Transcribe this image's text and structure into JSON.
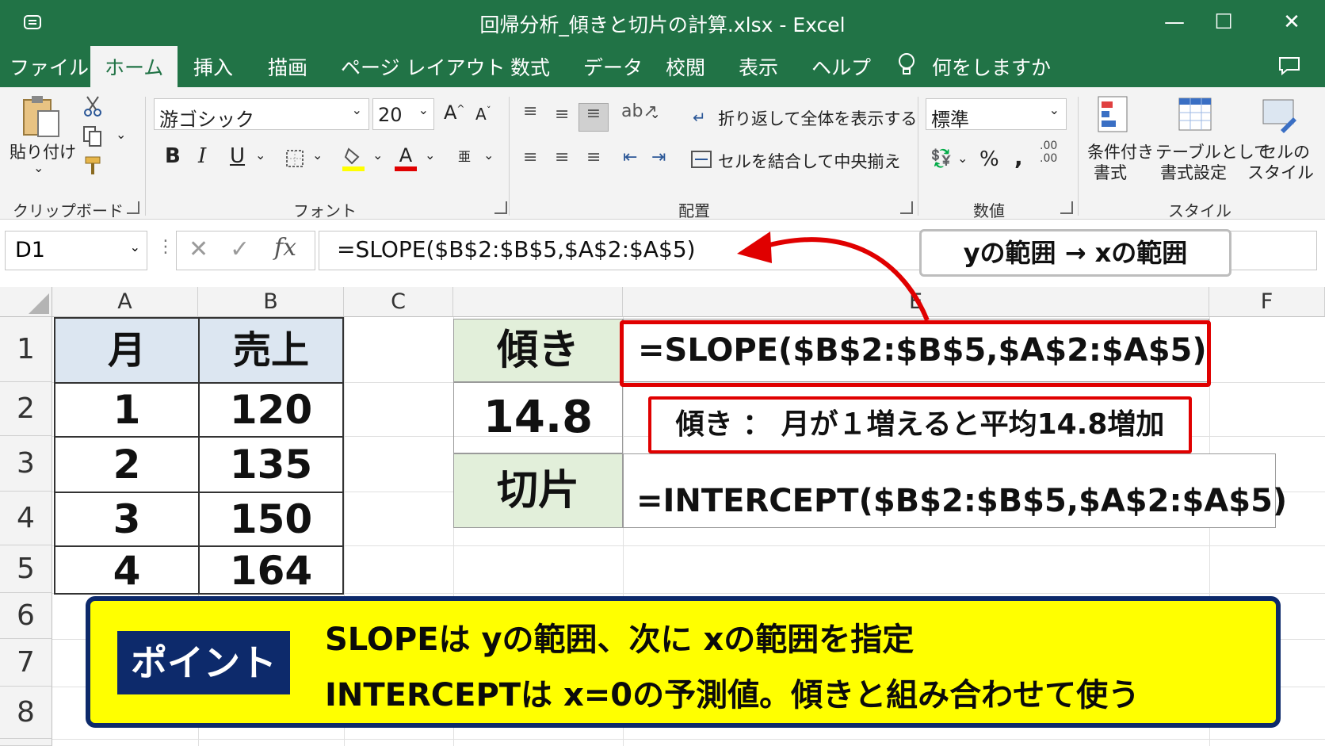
{
  "window": {
    "title": "回帰分析_傾きと切片の計算.xlsx  -  Excel",
    "minimize": "—",
    "maximize": "☐",
    "close": "✕"
  },
  "menu": {
    "file": "ファイル",
    "tabs": [
      "ホーム",
      "挿入",
      "描画",
      "ページ レイアウト",
      "数式",
      "データ",
      "校閲",
      "表示",
      "ヘルプ"
    ],
    "tell_me": "何をしますか"
  },
  "ribbon": {
    "clipboard": {
      "paste": "貼り付け",
      "label": "クリップボード"
    },
    "font": {
      "name": "游ゴシック",
      "size": "20",
      "bold": "B",
      "italic": "I",
      "underline": "U",
      "label": "フォント"
    },
    "alignment": {
      "wrap": "折り返して全体を表示する",
      "merge": "セルを結合して中央揃え",
      "label": "配置"
    },
    "number": {
      "format": "標準",
      "percent": "%",
      "comma": ",",
      "label": "数値"
    },
    "styles": {
      "conditional_line1": "条件付き",
      "conditional_line2": "書式",
      "table_line1": "テーブルとして",
      "table_line2": "書式設定",
      "cell_line1": "セルの",
      "cell_line2": "スタイル",
      "label": "スタイル"
    }
  },
  "formula_bar": {
    "name_box": "D1",
    "fx": "fx",
    "formula": "=SLOPE($B$2:$B$5,$A$2:$A$5)"
  },
  "annotation_callout": "yの範囲 → xの範囲",
  "columns": [
    "A",
    "B",
    "C",
    "",
    "E",
    "F"
  ],
  "rows": [
    "1",
    "2",
    "3",
    "4",
    "5",
    "6",
    "7",
    "8"
  ],
  "table": {
    "headers": [
      "月",
      "売上"
    ],
    "rows": [
      [
        "1",
        "120"
      ],
      [
        "2",
        "135"
      ],
      [
        "3",
        "150"
      ],
      [
        "4",
        "164"
      ]
    ]
  },
  "calc": {
    "slope_label": "傾き",
    "slope_formula": "=SLOPE($B$2:$B$5,$A$2:$A$5)",
    "slope_value": "14.8",
    "slope_note": "傾き ： 月が１増えると平均14.8増加",
    "intercept_label": "切片",
    "intercept_formula": "=INTERCEPT($B$2:$B$5,$A$2:$A$5)"
  },
  "point_box": {
    "tag": "ポイント",
    "line1": "SLOPEは yの範囲、次に xの範囲を指定",
    "line2": "INTERCEPTは x=0の予測値。傾きと組み合わせて使う"
  },
  "colors": {
    "excel_green": "#217346",
    "header_blue": "#dce6f1",
    "label_green": "#e2efda",
    "highlight_red": "#e00000",
    "point_yellow": "#ffff00",
    "point_navy": "#0d2a6b"
  }
}
